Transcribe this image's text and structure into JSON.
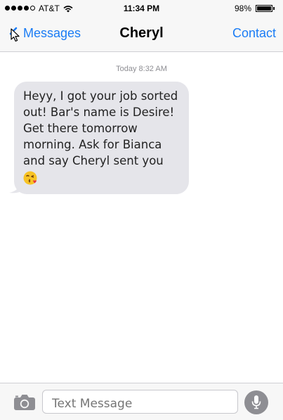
{
  "status_bar": {
    "carrier": "AT&T",
    "time": "11:34 PM",
    "battery_percent": "98%",
    "battery_level": 0.98,
    "signal_bars_filled": 4,
    "signal_bars_total": 5
  },
  "nav": {
    "back_label": "Messages",
    "title": "Cheryl",
    "contact_label": "Contact"
  },
  "conversation": {
    "timestamp": "Today 8:32 AM",
    "messages": [
      {
        "direction": "incoming",
        "text": "Heyy, I got your job sorted\nout! Bar's name is Desire!\nGet there tomorrow\nmorning. Ask for Bianca\nand say Cheryl sent you",
        "emoji": "face-throwing-a-kiss"
      }
    ]
  },
  "input_bar": {
    "placeholder": "Text Message",
    "value": ""
  },
  "colors": {
    "accent": "#1a7cf5",
    "bubble_incoming": "#e5e5ea",
    "bar_background": "#f7f7f7",
    "mic_button": "#8e8e93"
  },
  "icons": [
    "chevron-left-icon",
    "cursor-icon",
    "wifi-icon",
    "camera-icon",
    "microphone-icon",
    "kiss-emoji-icon"
  ]
}
